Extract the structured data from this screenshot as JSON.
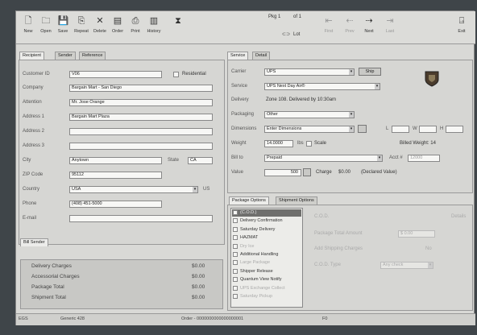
{
  "toolbar": [
    {
      "label": "New",
      "icon": "new-doc-icon",
      "glyph": "🗋"
    },
    {
      "label": "Open",
      "icon": "open-icon",
      "glyph": "🗀"
    },
    {
      "label": "Save",
      "icon": "save-icon",
      "glyph": "💾"
    },
    {
      "label": "Repeat",
      "icon": "repeat-icon",
      "glyph": "⎘"
    },
    {
      "label": "Delete",
      "icon": "delete-icon",
      "glyph": "✕"
    },
    {
      "label": "Order",
      "icon": "order-icon",
      "glyph": "▤"
    },
    {
      "label": "Print",
      "icon": "print-icon",
      "glyph": "⎙"
    },
    {
      "label": "History",
      "icon": "history-icon",
      "glyph": "▥"
    },
    {
      "label": "",
      "icon": "hourglass-icon",
      "glyph": "⧗"
    }
  ],
  "nav": {
    "pkg_label": "Pkg 1",
    "of_label": "of 1",
    "lot": "Lot",
    "buttons": [
      "First",
      "Prev",
      "Next",
      "Last"
    ],
    "exit": "Exit"
  },
  "left_tabs": [
    "Recipient",
    "Sender",
    "Reference"
  ],
  "recipient": {
    "customer_id_label": "Customer ID",
    "customer_id": "V06",
    "residential": "Residential",
    "company_label": "Company",
    "company": "Bargain Mart - San Diego",
    "attention_label": "Attention",
    "attention": "Mr. Jose Orange",
    "address1_label": "Address 1",
    "address1": "Bargain Mart Plaza",
    "address2_label": "Address 2",
    "address3_label": "Address 3",
    "city_label": "City",
    "city": "Anytown",
    "state_label": "State",
    "state": "CA",
    "zip_label": "ZIP Code",
    "zip": "95112",
    "country_label": "Country",
    "country": "USA",
    "country_code": "US",
    "phone_label": "Phone",
    "phone": "(408) 451-5000",
    "email_label": "E-mail"
  },
  "bill_tab": "Bill Sender",
  "charges": [
    {
      "label": "Delivery Charges",
      "value": "$0.00"
    },
    {
      "label": "Accessorial Charges",
      "value": "$0.00"
    },
    {
      "label": "Package Total",
      "value": "$0.00"
    },
    {
      "label": "Shipment Total",
      "value": "$0.00"
    }
  ],
  "right_tabs": [
    "Service",
    "Detail"
  ],
  "service": {
    "carrier_label": "Carrier",
    "carrier": "UPS",
    "ship_btn": "Ship",
    "service_label": "Service",
    "service": "UPS Next Day Air®",
    "delivery_label": "Delivery",
    "delivery": "Zone 108. Delivered by 10:30am",
    "packaging_label": "Packaging",
    "packaging": "Other",
    "dimensions_label": "Dimensions",
    "dimensions": "Enter Dimensions",
    "l": "L",
    "w": "W",
    "h": "H",
    "weight_label": "Weight",
    "weight": "14.0000",
    "weight_unit": "lbs",
    "scale_label": "Scale",
    "billed_weight": "Billed Weight: 14",
    "bill_to_label": "Bill to",
    "bill_to": "Prepaid",
    "acct_label": "Acct #",
    "acct": "12000",
    "value_label": "Value",
    "value": "500",
    "charge_label": "Charge",
    "charge": "$0.00",
    "declared": "(Declared Value)"
  },
  "bottom_tabs": [
    "Package Options",
    "Shipment Options"
  ],
  "options": [
    "(C.O.D.)",
    "Delivery Confirmation",
    "Saturday Delivery",
    "HAZMAT",
    "Dry Ice",
    "Additional Handling",
    "Large Package",
    "Shipper Release",
    "Quantum View Notify",
    "UPS Exchange Collect",
    "Saturday Pickup"
  ],
  "cod_panel": {
    "title": "C.O.D.",
    "btn": "Details",
    "amount_label": "Package Total Amount",
    "amount": "$ 0.00",
    "add_label": "Add Shipping Charges",
    "add_val": "No",
    "type_label": "C.O.D. Type",
    "type": "Any check"
  },
  "status": [
    "EGS",
    "Generic 428",
    "Order - 0000000000000000001",
    "F0"
  ],
  "colors": {
    "window": "#d9d9d6",
    "desktop": "#3f4549",
    "input": "#f7f7f5",
    "selection": "#6f6f6d"
  }
}
